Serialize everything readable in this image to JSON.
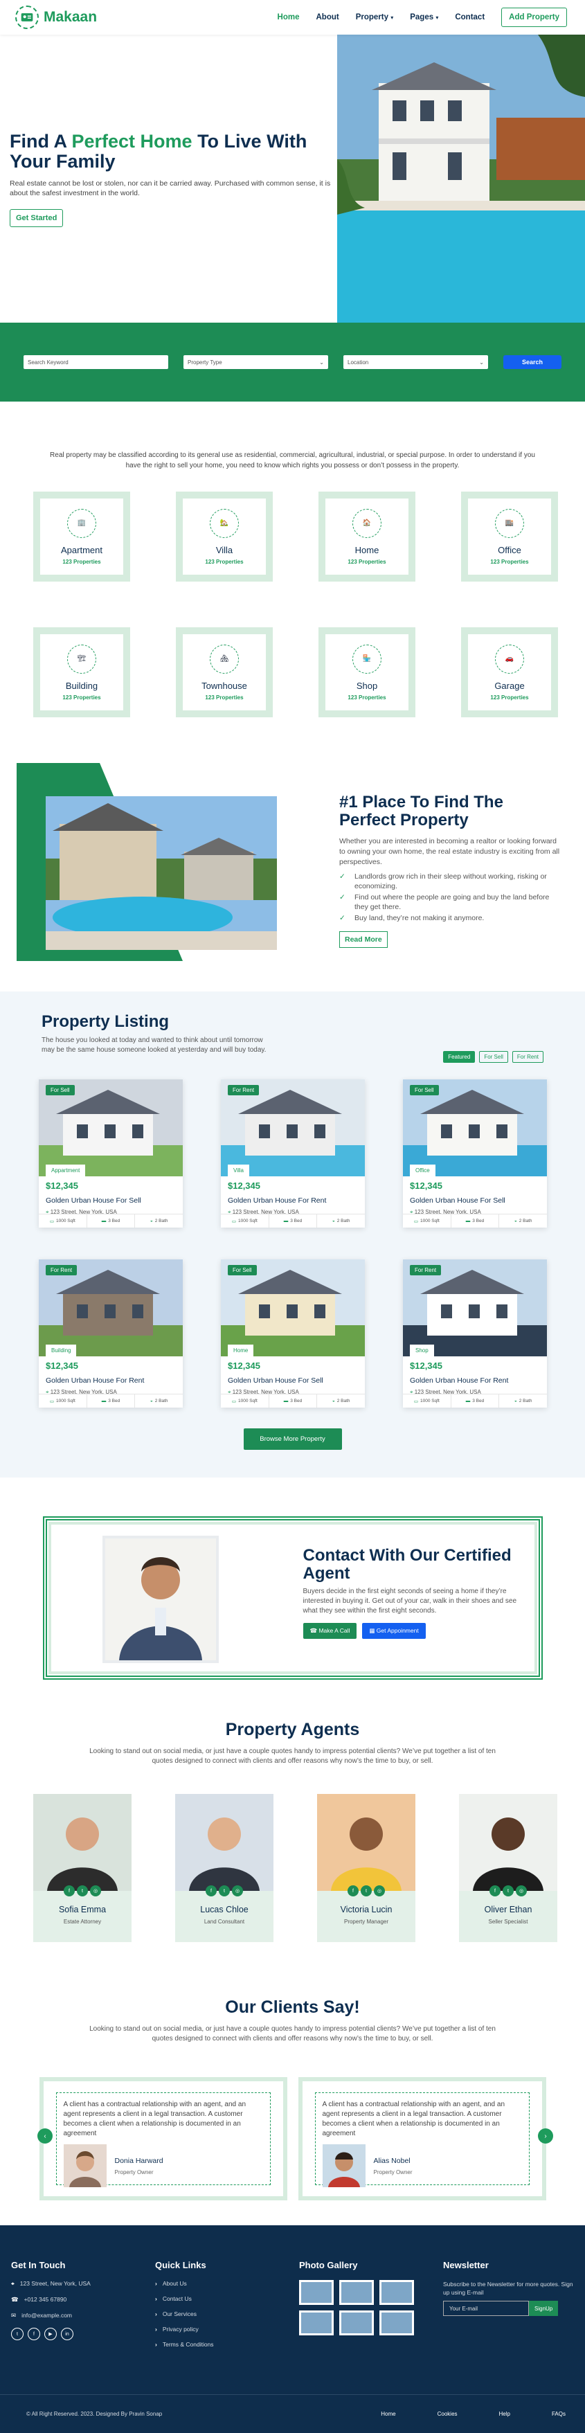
{
  "nav": {
    "brand": "Makaan",
    "items": [
      "Home",
      "About",
      "Property",
      "Pages",
      "Contact"
    ],
    "cta": "Add Property"
  },
  "hero": {
    "title_a": "Find A ",
    "title_b": "Perfect Home",
    "title_c": " To Live With Your Family",
    "text": "Real estate cannot be lost or stolen, nor can it be carried away. Purchased with common sense, it is about the safest investment in the world.",
    "button": "Get Started"
  },
  "search": {
    "keyword_placeholder": "Search Keyword",
    "type": "Property Type",
    "location": "Location",
    "button": "Search"
  },
  "intro": "Real property may be classified according to its general use as residential, commercial, agricultural, industrial, or special purpose. In order to understand if you have the right to sell your home, you need to know which rights you possess or don’t possess in the property.",
  "categories": [
    {
      "name": "Apartment",
      "count": "123 Properties"
    },
    {
      "name": "Villa",
      "count": "123 Properties"
    },
    {
      "name": "Home",
      "count": "123 Properties"
    },
    {
      "name": "Office",
      "count": "123 Properties"
    },
    {
      "name": "Building",
      "count": "123 Properties"
    },
    {
      "name": "Townhouse",
      "count": "123 Properties"
    },
    {
      "name": "Shop",
      "count": "123 Properties"
    },
    {
      "name": "Garage",
      "count": "123 Properties"
    }
  ],
  "about": {
    "title": "#1 Place To Find The Perfect Property",
    "text": "Whether you are interested in becoming a realtor or looking forward to owning your own home, the real estate industry is exciting from all perspectives.",
    "points": [
      "Landlords grow rich in their sleep without working, risking or economizing.",
      "Find out where the people are going and buy the land before they get there.",
      "Buy land, they’re not making it anymore."
    ],
    "button": "Read More"
  },
  "listing": {
    "title": "Property Listing",
    "text": "The house you looked at today and wanted to think about until tomorrow may be the same house someone looked at yesterday and will buy today.",
    "tabs": [
      "Featured",
      "For Sell",
      "For Rent"
    ],
    "cards": [
      {
        "badge": "For Sell",
        "type": "Appartment",
        "price": "$12,345",
        "title": "Golden Urban House For Sell",
        "address": "123 Street, New York, USA",
        "sqft": "1000 Sqft",
        "bed": "3 Bed",
        "bath": "2 Bath"
      },
      {
        "badge": "For Rent",
        "type": "Villa",
        "price": "$12,345",
        "title": "Golden Urban House For Rent",
        "address": "123 Street, New York, USA",
        "sqft": "1000 Sqft",
        "bed": "3 Bed",
        "bath": "2 Bath"
      },
      {
        "badge": "For Sell",
        "type": "Office",
        "price": "$12,345",
        "title": "Golden Urban House For Sell",
        "address": "123 Street, New York, USA",
        "sqft": "1000 Sqft",
        "bed": "3 Bed",
        "bath": "2 Bath"
      },
      {
        "badge": "For Rent",
        "type": "Building",
        "price": "$12,345",
        "title": "Golden Urban House For Rent",
        "address": "123 Street, New York, USA",
        "sqft": "1000 Sqft",
        "bed": "3 Bed",
        "bath": "2 Bath"
      },
      {
        "badge": "For Sell",
        "type": "Home",
        "price": "$12,345",
        "title": "Golden Urban House For Sell",
        "address": "123 Street, New York, USA",
        "sqft": "1000 Sqft",
        "bed": "3 Bed",
        "bath": "2 Bath"
      },
      {
        "badge": "For Rent",
        "type": "Shop",
        "price": "$12,345",
        "title": "Golden Urban House For Rent",
        "address": "123 Street, New York, USA",
        "sqft": "1000 Sqft",
        "bed": "3 Bed",
        "bath": "2 Bath"
      }
    ],
    "button": "Browse More Property"
  },
  "contact": {
    "title": "Contact With Our Certified Agent",
    "text": "Buyers decide in the first eight seconds of seeing a home if they’re interested in buying it. Get out of your car, walk in their shoes and see what they see within the first eight seconds.",
    "call": "Make A Call",
    "appt": "Get Appoinment"
  },
  "agents": {
    "title": "Property Agents",
    "text": "Looking to stand out on social media, or just have a couple quotes handy to impress potential clients? We’ve put together a list of ten quotes designed to connect with clients and offer reasons why now’s the time to buy, or sell.",
    "list": [
      {
        "name": "Sofia Emma",
        "role": "Estate Attorney"
      },
      {
        "name": "Lucas Chloe",
        "role": "Land Consultant"
      },
      {
        "name": "Victoria Lucin",
        "role": "Property Manager"
      },
      {
        "name": "Oliver Ethan",
        "role": "Seller Specialist"
      }
    ]
  },
  "clients": {
    "title": "Our Clients Say!",
    "text": "Looking to stand out on social media, or just have a couple quotes handy to impress potential clients? We’ve put together a list of ten quotes designed to connect with clients and offer reasons why now’s the time to buy, or sell.",
    "list": [
      {
        "quote": "A client has a contractual relationship with an agent, and an agent represents a client in a legal transaction. A customer becomes a client when a relationship is documented in an agreement",
        "name": "Donia Harward",
        "role": "Property Owner"
      },
      {
        "quote": "A client has a contractual relationship with an agent, and an agent represents a client in a legal transaction. A customer becomes a client when a relationship is documented in an agreement",
        "name": "Alias Nobel",
        "role": "Property Owner"
      }
    ]
  },
  "footer": {
    "touch": "Get In Touch",
    "address": "123 Street, New York, USA",
    "phone": "+012 345 67890",
    "email": "info@example.com",
    "quick": "Quick Links",
    "links": [
      "About Us",
      "Contact Us",
      "Our Services",
      "Privacy policy",
      "Terms & Conditions"
    ],
    "gallery": "Photo Gallery",
    "news": "Newsletter",
    "news_text": "Subscribe to the Newsletter for more quotes. Sign up using E-mail",
    "news_placeholder": "Your E-mail",
    "news_btn": "SignUp",
    "copyright": "© All Right Reserved. 2023. Designed By Pravin Sonap",
    "bottom_links": [
      "Home",
      "Cookies",
      "Help",
      "FAQs"
    ]
  }
}
